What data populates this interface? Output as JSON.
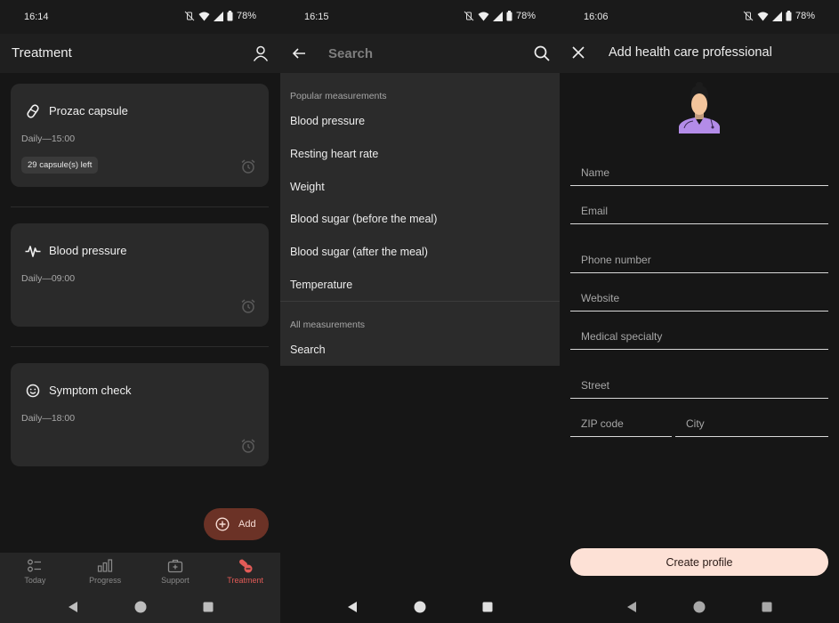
{
  "colors": {
    "accent": "#e25b57",
    "fab_background": "#6b3226",
    "primary_button": "#fde1d6",
    "card_background": "#2a2a2a",
    "app_background": "#161616"
  },
  "treatment_screen": {
    "status_bar": {
      "time": "16:14",
      "battery": "78%"
    },
    "app_bar": {
      "title": "Treatment",
      "profile_icon": "person-icon"
    },
    "cards": [
      {
        "icon": "pill-icon",
        "title": "Prozac capsule",
        "schedule": "Daily—15:00",
        "chip": "29 capsule(s) left",
        "alarm_icon": "alarm-icon"
      },
      {
        "icon": "heart-pulse-icon",
        "title": "Blood pressure",
        "schedule": "Daily—09:00",
        "alarm_icon": "alarm-icon"
      },
      {
        "icon": "smiley-icon",
        "title": "Symptom check",
        "schedule": "Daily—18:00",
        "alarm_icon": "alarm-icon"
      }
    ],
    "fab": {
      "icon": "plus-circle-icon",
      "label": "Add"
    },
    "bottom_nav": [
      {
        "icon": "checklist-icon",
        "label": "Today",
        "active": false
      },
      {
        "icon": "bar-chart-icon",
        "label": "Progress",
        "active": false
      },
      {
        "icon": "first-aid-kit-icon",
        "label": "Support",
        "active": false
      },
      {
        "icon": "pills-icon",
        "label": "Treatment",
        "active": true
      }
    ]
  },
  "search_screen": {
    "status_bar": {
      "time": "16:15",
      "battery": "78%"
    },
    "search": {
      "placeholder": "Search",
      "value": ""
    },
    "popular_header": "Popular measurements",
    "popular_items": [
      "Blood pressure",
      "Resting heart rate",
      "Weight",
      "Blood sugar (before the meal)",
      "Blood sugar (after the meal)",
      "Temperature"
    ],
    "all_header": "All measurements",
    "all_items": [
      "Search"
    ]
  },
  "add_professional_screen": {
    "status_bar": {
      "time": "16:06",
      "battery": "78%"
    },
    "app_bar": {
      "title": "Add health care professional"
    },
    "fields": {
      "name": {
        "placeholder": "Name",
        "value": ""
      },
      "email": {
        "placeholder": "Email",
        "value": ""
      },
      "phone": {
        "placeholder": "Phone number",
        "value": ""
      },
      "website": {
        "placeholder": "Website",
        "value": ""
      },
      "specialty": {
        "placeholder": "Medical specialty",
        "value": ""
      },
      "street": {
        "placeholder": "Street",
        "value": ""
      },
      "zip": {
        "placeholder": "ZIP code",
        "value": ""
      },
      "city": {
        "placeholder": "City",
        "value": ""
      }
    },
    "create_button": "Create profile"
  }
}
